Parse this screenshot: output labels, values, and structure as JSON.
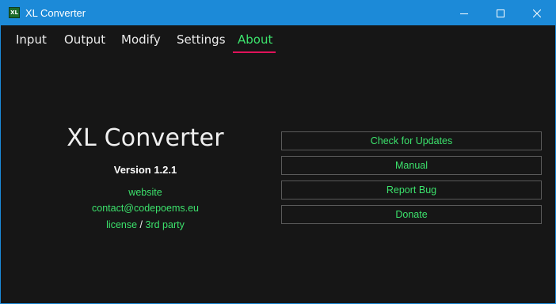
{
  "window": {
    "title": "XL Converter",
    "icon_text": "XL"
  },
  "tabs": [
    {
      "label": "Input",
      "active": false
    },
    {
      "label": "Output",
      "active": false
    },
    {
      "label": "Modify",
      "active": false
    },
    {
      "label": "Settings",
      "active": false
    },
    {
      "label": "About",
      "active": true
    }
  ],
  "about": {
    "app_name": "XL Converter",
    "version": "Version 1.2.1",
    "website_link": "website",
    "contact_link": "contact@codepoems.eu",
    "license_link": "license",
    "separator": " / ",
    "third_party_link": "3rd party"
  },
  "buttons": {
    "check_updates": "Check for Updates",
    "manual": "Manual",
    "report_bug": "Report Bug",
    "donate": "Donate"
  },
  "colors": {
    "accent": "#3ce26c",
    "tab_underline": "#e0125a",
    "titlebar": "#1c8ad8",
    "background": "#161616"
  }
}
